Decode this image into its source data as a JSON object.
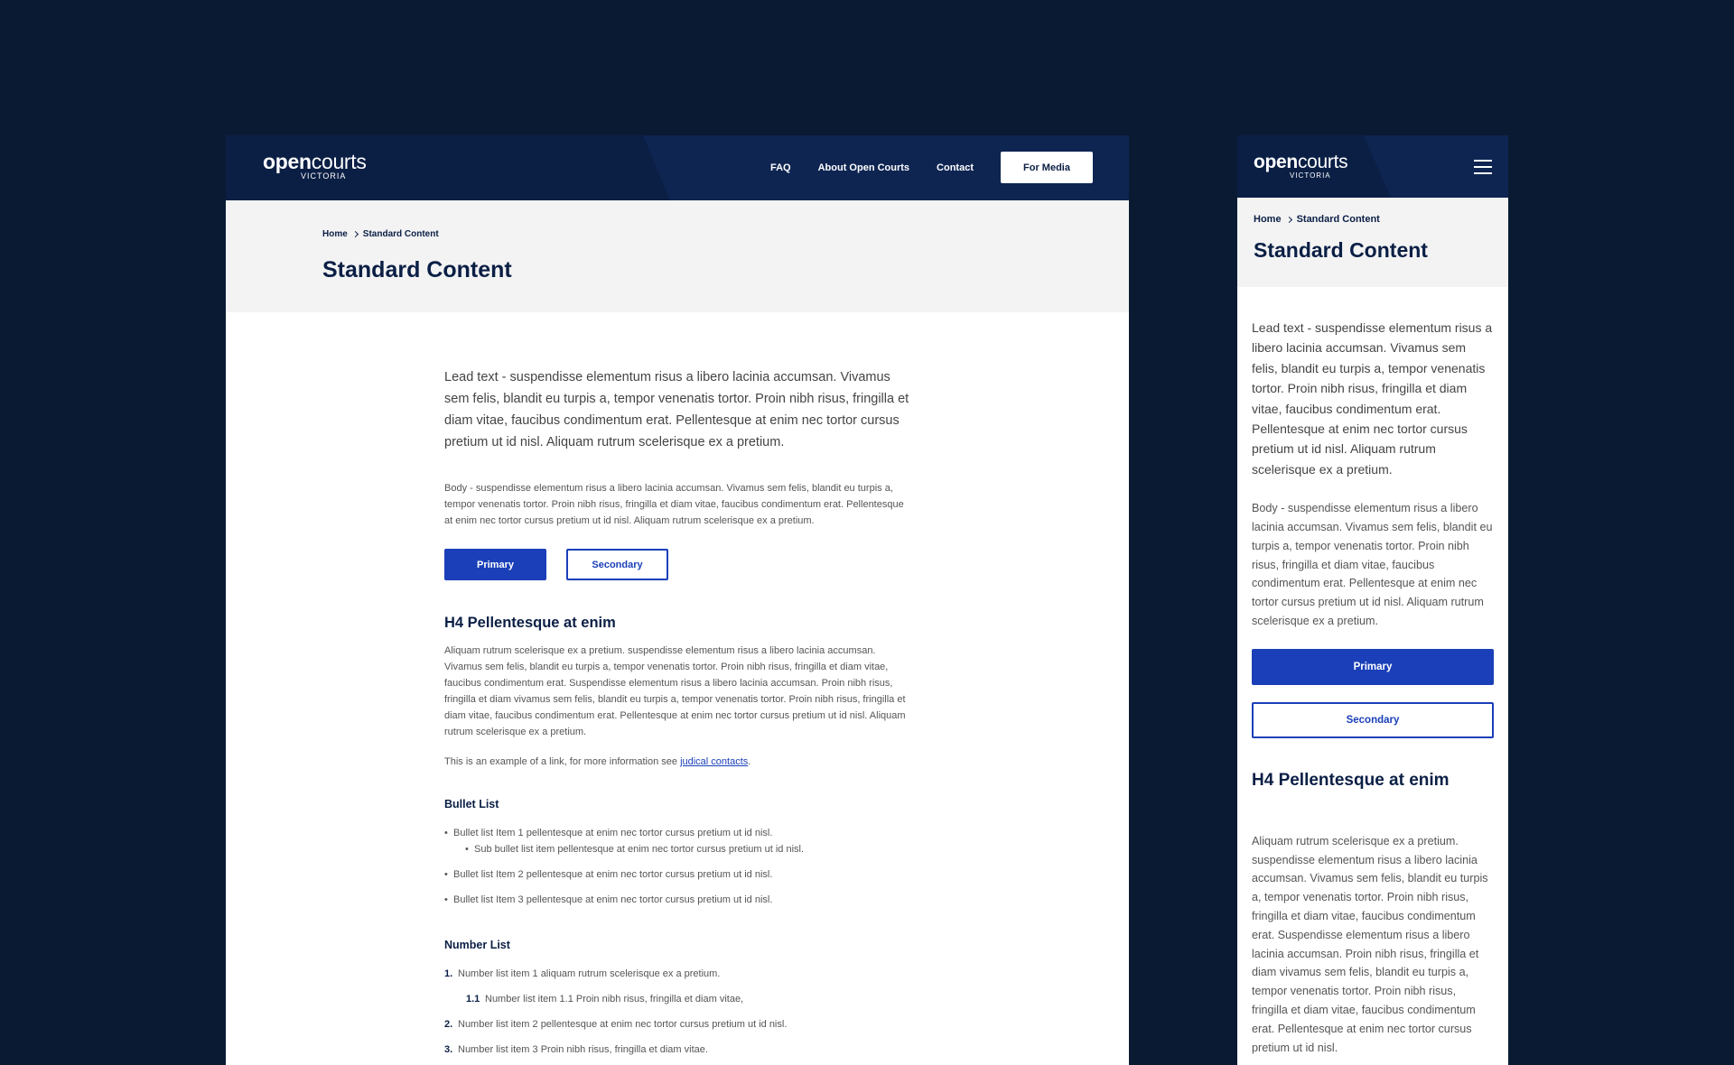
{
  "brand": {
    "word1": "open",
    "word2": "courts",
    "tagline": "VICTORIA"
  },
  "nav": {
    "faq": "FAQ",
    "about": "About Open Courts",
    "contact": "Contact",
    "media": "For Media"
  },
  "breadcrumb": {
    "home": "Home",
    "current": "Standard Content"
  },
  "page": {
    "title": "Standard Content",
    "lead": "Lead text - suspendisse elementum risus a libero lacinia accumsan. Vivamus sem felis, blandit eu turpis a, tempor venenatis tortor. Proin nibh risus, fringilla et diam vitae, faucibus condimentum erat. Pellentesque at enim nec tortor cursus pretium ut id nisl. Aliquam rutrum scelerisque ex a pretium.",
    "body": "Body - suspendisse elementum risus a libero lacinia accumsan. Vivamus sem felis, blandit eu turpis a, tempor venenatis tortor. Proin nibh risus, fringilla et diam vitae, faucibus condimentum erat. Pellentesque at enim nec tortor cursus pretium ut id nisl. Aliquam rutrum scelerisque ex a pretium.",
    "primary_label": "Primary",
    "secondary_label": "Secondary",
    "h4": "H4 Pellentesque at enim",
    "para": "Aliquam rutrum scelerisque ex a pretium. suspendisse elementum risus a libero lacinia accumsan. Vivamus sem felis, blandit eu turpis a, tempor venenatis tortor. Proin nibh risus, fringilla et diam vitae, faucibus condimentum erat. Suspendisse elementum risus a libero lacinia accumsan. Proin nibh risus, fringilla et diam vivamus sem felis, blandit eu turpis a, tempor venenatis tortor. Proin nibh risus, fringilla et diam vitae, faucibus condimentum erat. Pellentesque at enim nec tortor cursus pretium ut id nisl. Aliquam rutrum scelerisque ex a pretium.",
    "link_prefix": "This is an example of a link,  for more information see ",
    "link_text": "judical contacts",
    "link_suffix": ".",
    "bullet_heading": "Bullet List",
    "bullets": {
      "item1": "Bullet list Item 1 pellentesque at enim nec tortor cursus pretium ut id nisl.",
      "sub1": "Sub bullet list item pellentesque at enim nec tortor cursus pretium ut id nisl.",
      "item2": "Bullet list Item 2 pellentesque at enim nec tortor cursus pretium ut id nisl.",
      "item3": "Bullet list Item 3 pellentesque at enim nec tortor cursus pretium ut id nisl."
    },
    "number_heading": "Number List",
    "numbers": {
      "n1": "1.",
      "item1": "Number list item 1 aliquam rutrum scelerisque ex a pretium.",
      "n11": "1.1",
      "sub1": "Number list item 1.1 Proin nibh risus, fringilla et diam vitae,",
      "n2": "2.",
      "item2": "Number list item 2 pellentesque at enim nec tortor cursus pretium ut id nisl.",
      "n3": "3.",
      "item3": "Number list item 3 Proin nibh risus, fringilla et diam vitae."
    }
  },
  "mobile": {
    "para": "Aliquam rutrum scelerisque ex a pretium. suspendisse elementum risus a libero lacinia accumsan. Vivamus sem felis, blandit eu turpis a, tempor venenatis tortor. Proin nibh risus, fringilla et diam vitae, faucibus condimentum erat. Suspendisse elementum risus a libero lacinia accumsan. Proin nibh risus, fringilla et diam vivamus sem felis, blandit eu turpis a, tempor venenatis tortor. Proin nibh risus, fringilla et diam vitae, faucibus condimentum erat. Pellentesque at enim nec tortor cursus pretium ut id nisl.",
    "menu_icon": "hamburger-menu-icon"
  },
  "colors": {
    "navy": "#0b1f45",
    "accent": "#1a3fb8",
    "hero_bg": "#f3f3f4",
    "page_bg": "#0a1a33"
  }
}
